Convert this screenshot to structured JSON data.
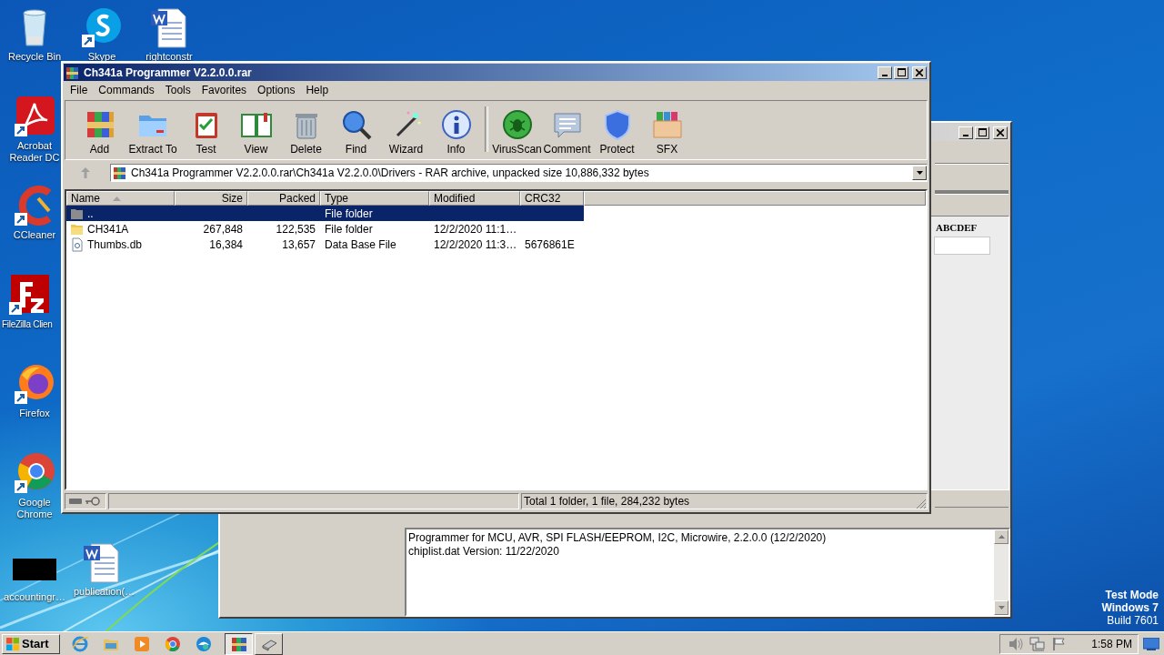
{
  "desktop_icons": [
    {
      "label": "Recycle Bin",
      "kind": "recycle-bin"
    },
    {
      "label": "Skype",
      "kind": "skype"
    },
    {
      "label": "rightconstr",
      "kind": "word-doc"
    },
    {
      "label": "Acrobat Reader DC",
      "kind": "acrobat"
    },
    {
      "label": "CCleaner",
      "kind": "ccleaner"
    },
    {
      "label": "FileZilla Clien",
      "kind": "filezilla"
    },
    {
      "label": "Firefox",
      "kind": "firefox"
    },
    {
      "label": "Google Chrome",
      "kind": "chrome"
    },
    {
      "label": "accountingr…",
      "kind": "black-thumb"
    },
    {
      "label": "publication(…",
      "kind": "word-doc"
    }
  ],
  "background_window": {
    "grid_header": "ABCDEF",
    "log_lines": [
      "Programmer for MCU, AVR, SPI FLASH/EEPROM, I2C, Microwire, 2.2.0.0 (12/2/2020)",
      "chiplist.dat Version: 11/22/2020"
    ]
  },
  "window": {
    "title": "Ch341a Programmer V2.2.0.0.rar",
    "menu": [
      "File",
      "Commands",
      "Tools",
      "Favorites",
      "Options",
      "Help"
    ],
    "toolbar": [
      {
        "label": "Add",
        "kind": "add"
      },
      {
        "label": "Extract To",
        "kind": "extract"
      },
      {
        "label": "Test",
        "kind": "test"
      },
      {
        "label": "View",
        "kind": "view"
      },
      {
        "label": "Delete",
        "kind": "delete"
      },
      {
        "label": "Find",
        "kind": "find"
      },
      {
        "label": "Wizard",
        "kind": "wizard"
      },
      {
        "label": "Info",
        "kind": "info"
      },
      {
        "label": "VirusScan",
        "kind": "virusscan"
      },
      {
        "label": "Comment",
        "kind": "comment"
      },
      {
        "label": "Protect",
        "kind": "protect"
      },
      {
        "label": "SFX",
        "kind": "sfx"
      }
    ],
    "address": "Ch341a Programmer V2.2.0.0.rar\\Ch341a V2.2.0.0\\Drivers - RAR archive, unpacked size 10,886,332 bytes",
    "columns": [
      {
        "label": "Name",
        "sorted": true
      },
      {
        "label": "Size",
        "sorted": false
      },
      {
        "label": "Packed",
        "sorted": false
      },
      {
        "label": "Type",
        "sorted": false
      },
      {
        "label": "Modified",
        "sorted": false
      },
      {
        "label": "CRC32",
        "sorted": false
      }
    ],
    "rows": [
      {
        "kind": "parent",
        "name": "..",
        "type": "File folder",
        "selected": true
      },
      {
        "kind": "folder",
        "name": "CH341A",
        "size": "267,848",
        "packed": "122,535",
        "type": "File folder",
        "modified": "12/2/2020 11:1…",
        "selected": false
      },
      {
        "kind": "file",
        "name": "Thumbs.db",
        "size": "16,384",
        "packed": "13,657",
        "type": "Data Base File",
        "modified": "12/2/2020 11:3…",
        "crc32": "5676861E",
        "selected": false
      }
    ],
    "status": "Total 1 folder, 1 file, 284,232 bytes"
  },
  "taskbar": {
    "start": "Start",
    "apps": [
      {
        "kind": "ie",
        "selected": false
      },
      {
        "kind": "explorer",
        "selected": false
      },
      {
        "kind": "media",
        "selected": false
      },
      {
        "kind": "chrome",
        "selected": false
      },
      {
        "kind": "edge",
        "selected": false
      },
      {
        "kind": "winrar",
        "selected": true
      },
      {
        "kind": "programmer",
        "selected": false
      }
    ],
    "clock": "1:58 PM"
  },
  "os_watermark": [
    "Test Mode",
    "Windows 7",
    "Build 7601"
  ]
}
